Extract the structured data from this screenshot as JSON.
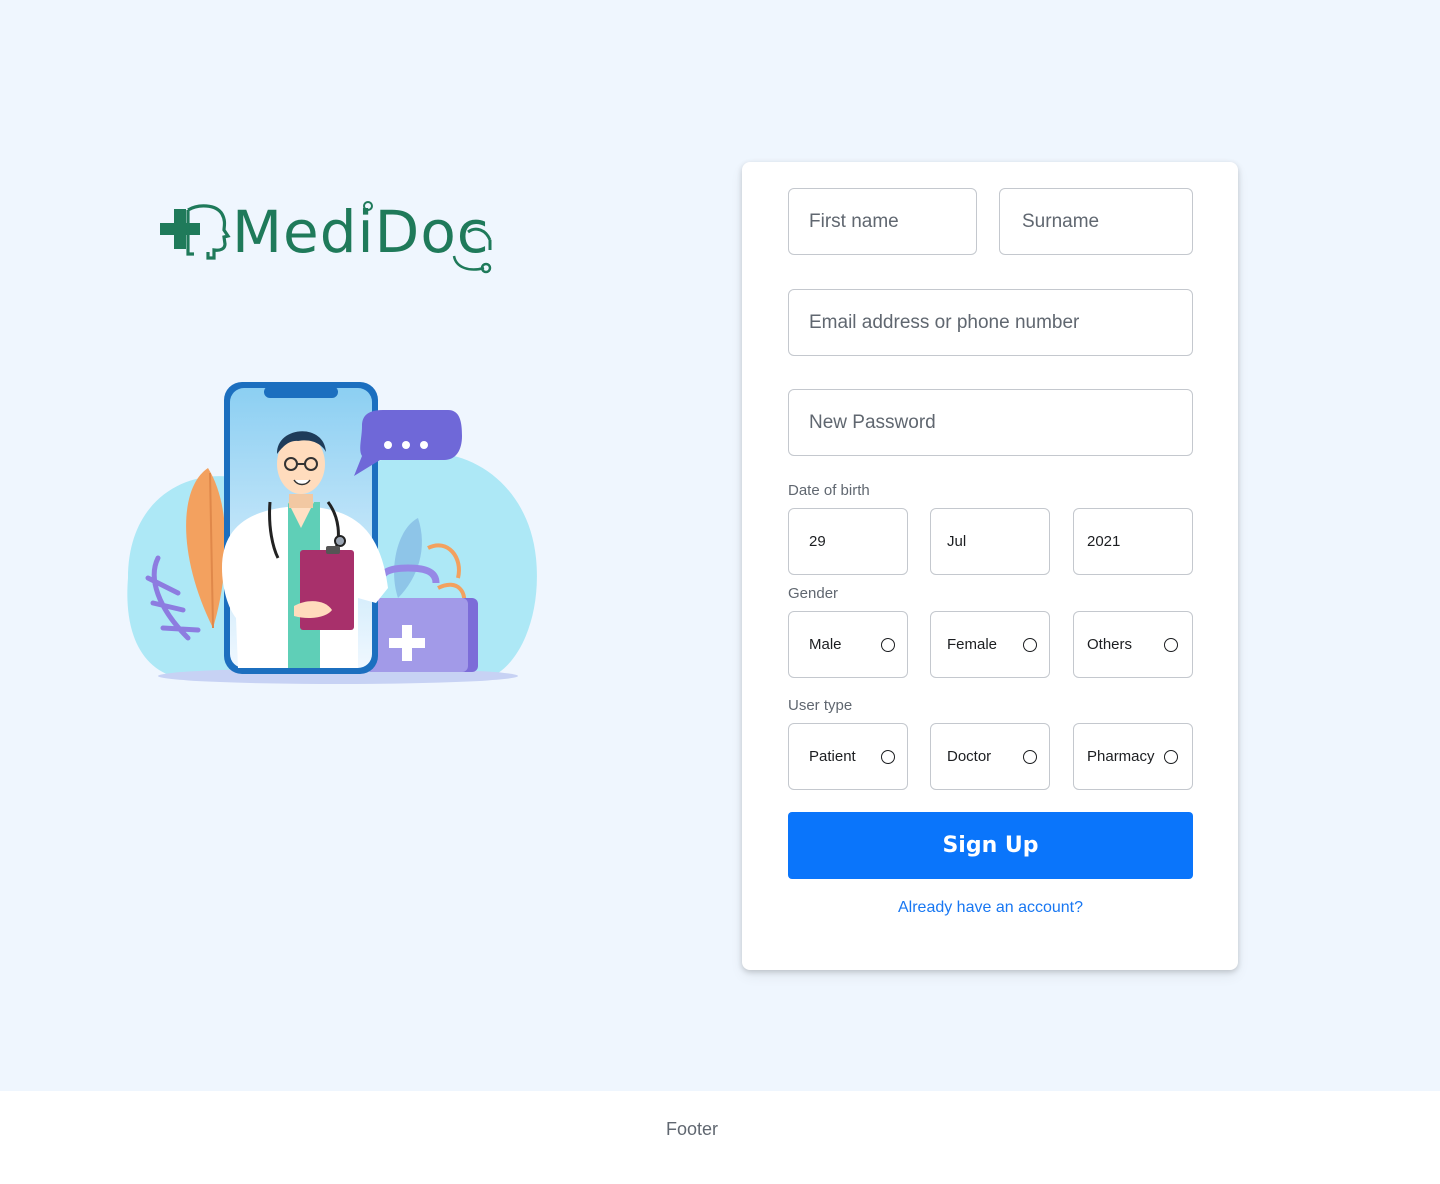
{
  "brand": {
    "name": "MediDoc",
    "color": "#1f7a5a"
  },
  "form": {
    "first_name_placeholder": "First name",
    "surname_placeholder": "Surname",
    "email_placeholder": "Email address or phone number",
    "password_placeholder": "New Password",
    "dob_label": "Date of birth",
    "dob_day": "29",
    "dob_month": "Jul",
    "dob_year": "2021",
    "gender_label": "Gender",
    "gender_options": [
      "Male",
      "Female",
      "Others"
    ],
    "user_type_label": "User type",
    "user_type_options": [
      "Patient",
      "Doctor",
      "Pharmacy"
    ],
    "submit_label": "Sign Up",
    "login_link": "Already have an account?"
  },
  "footer": {
    "label": "Footer"
  },
  "colors": {
    "primary": "#0a75fb",
    "background": "#eff6fe",
    "link": "#1877f2"
  }
}
